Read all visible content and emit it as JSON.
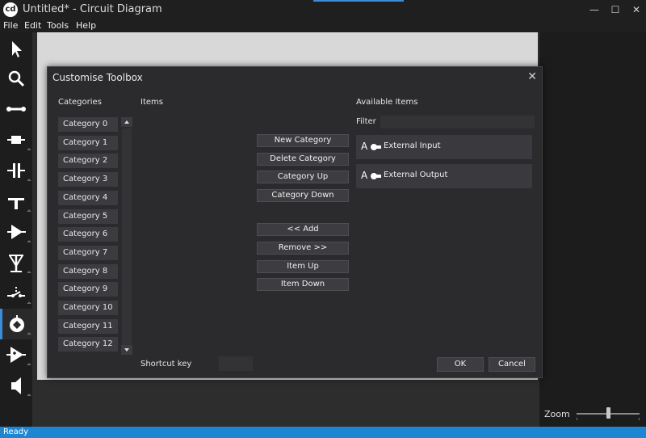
{
  "window": {
    "title": "Untitled* - Circuit Diagram",
    "logo": "cd"
  },
  "menu": [
    "File",
    "Edit",
    "Tools",
    "Help"
  ],
  "window_controls": {
    "minimize": "—",
    "maximize": "☐",
    "close": "✕"
  },
  "toolbar_tools": [
    "pointer-tool-icon",
    "magnifier-tool-icon",
    "wire-tool-icon",
    "resistor-tool-icon",
    "capacitor-tool-icon",
    "ground-tool-icon",
    "diode-tool-icon",
    "antenna-tool-icon",
    "switch-tool-icon",
    "lamp-tool-icon",
    "opamp-tool-icon",
    "speaker-tool-icon"
  ],
  "dialog": {
    "title": "Customise Toolbox",
    "close": "✕",
    "categories_label": "Categories",
    "items_label": "Items",
    "available_label": "Available Items",
    "filter_label": "Filter",
    "filter_value": "",
    "shortcut_label": "Shortcut key",
    "shortcut_value": "",
    "categories": [
      "Category 0",
      "Category 1",
      "Category 2",
      "Category 3",
      "Category 4",
      "Category 5",
      "Category 6",
      "Category 7",
      "Category 8",
      "Category 9",
      "Category 10",
      "Category 11",
      "Category 12"
    ],
    "buttons": {
      "new_category": "New Category",
      "delete_category": "Delete Category",
      "category_up": "Category Up",
      "category_down": "Category Down",
      "add": "<< Add",
      "remove": "Remove >>",
      "item_up": "Item Up",
      "item_down": "Item Down",
      "ok": "OK",
      "cancel": "Cancel"
    },
    "available_items": [
      {
        "label": "External Input",
        "icon_letter": "A"
      },
      {
        "label": "External Output",
        "icon_letter": "A"
      }
    ]
  },
  "zoom": {
    "label": "Zoom",
    "level": 0.5
  },
  "status": {
    "text": "Ready"
  },
  "colors": {
    "accent": "#3c8dd8",
    "statusbar": "#1d86d2"
  }
}
